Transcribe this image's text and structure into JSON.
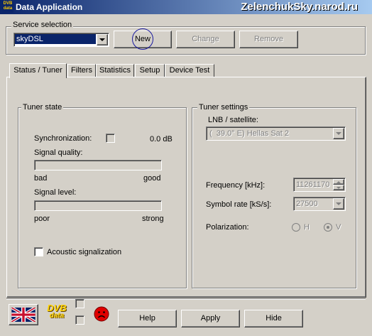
{
  "window": {
    "title": "Data Application",
    "watermark": "ZelenchukSky.narod.ru",
    "icon_text": "DVB data"
  },
  "service_selection": {
    "label": "Service selection",
    "selected_service": "skyDSL",
    "new_label": "New",
    "change_label": "Change",
    "remove_label": "Remove"
  },
  "tabs": [
    {
      "label": "Status / Tuner",
      "active": true
    },
    {
      "label": "Filters",
      "active": false
    },
    {
      "label": "Statistics",
      "active": false
    },
    {
      "label": "Setup",
      "active": false
    },
    {
      "label": "Device Test",
      "active": false
    }
  ],
  "tuner_state": {
    "label": "Tuner state",
    "synchronization_label": "Synchronization:",
    "synchronization_value": "0.0 dB",
    "signal_quality_label": "Signal quality:",
    "quality_low": "bad",
    "quality_high": "good",
    "signal_quality_fraction": 0,
    "signal_level_label": "Signal level:",
    "level_low": "poor",
    "level_high": "strong",
    "signal_level_fraction": 0,
    "acoustic_label": "Acoustic signalization"
  },
  "tuner_settings": {
    "label": "Tuner settings",
    "lnb_label": "LNB / satellite:",
    "lnb_value": "(  39.0° E) Hellas Sat 2",
    "frequency_label": "Frequency [kHz]:",
    "frequency_value": "11261170",
    "symbol_rate_label": "Symbol rate [kS/s]:",
    "symbol_rate_value": "27500",
    "polarization_label": "Polarization:",
    "pol_h": "H",
    "pol_v": "V",
    "pol_selected": "V"
  },
  "bottom": {
    "logo_top": "DVB",
    "logo_bottom": "data",
    "help_label": "Help",
    "apply_label": "Apply",
    "hide_label": "Hide"
  },
  "colors": {
    "titlebar_start": "#0a246a",
    "titlebar_end": "#a6caf0",
    "selection": "#0a246a",
    "status_red": "#e00000",
    "highlight_ring": "#1a1aa0"
  },
  "icons": [
    "uk-flag-icon",
    "dvb-data-logo",
    "sad-face-icon",
    "dropdown-arrow-icon",
    "spin-up-icon",
    "spin-down-icon"
  ]
}
